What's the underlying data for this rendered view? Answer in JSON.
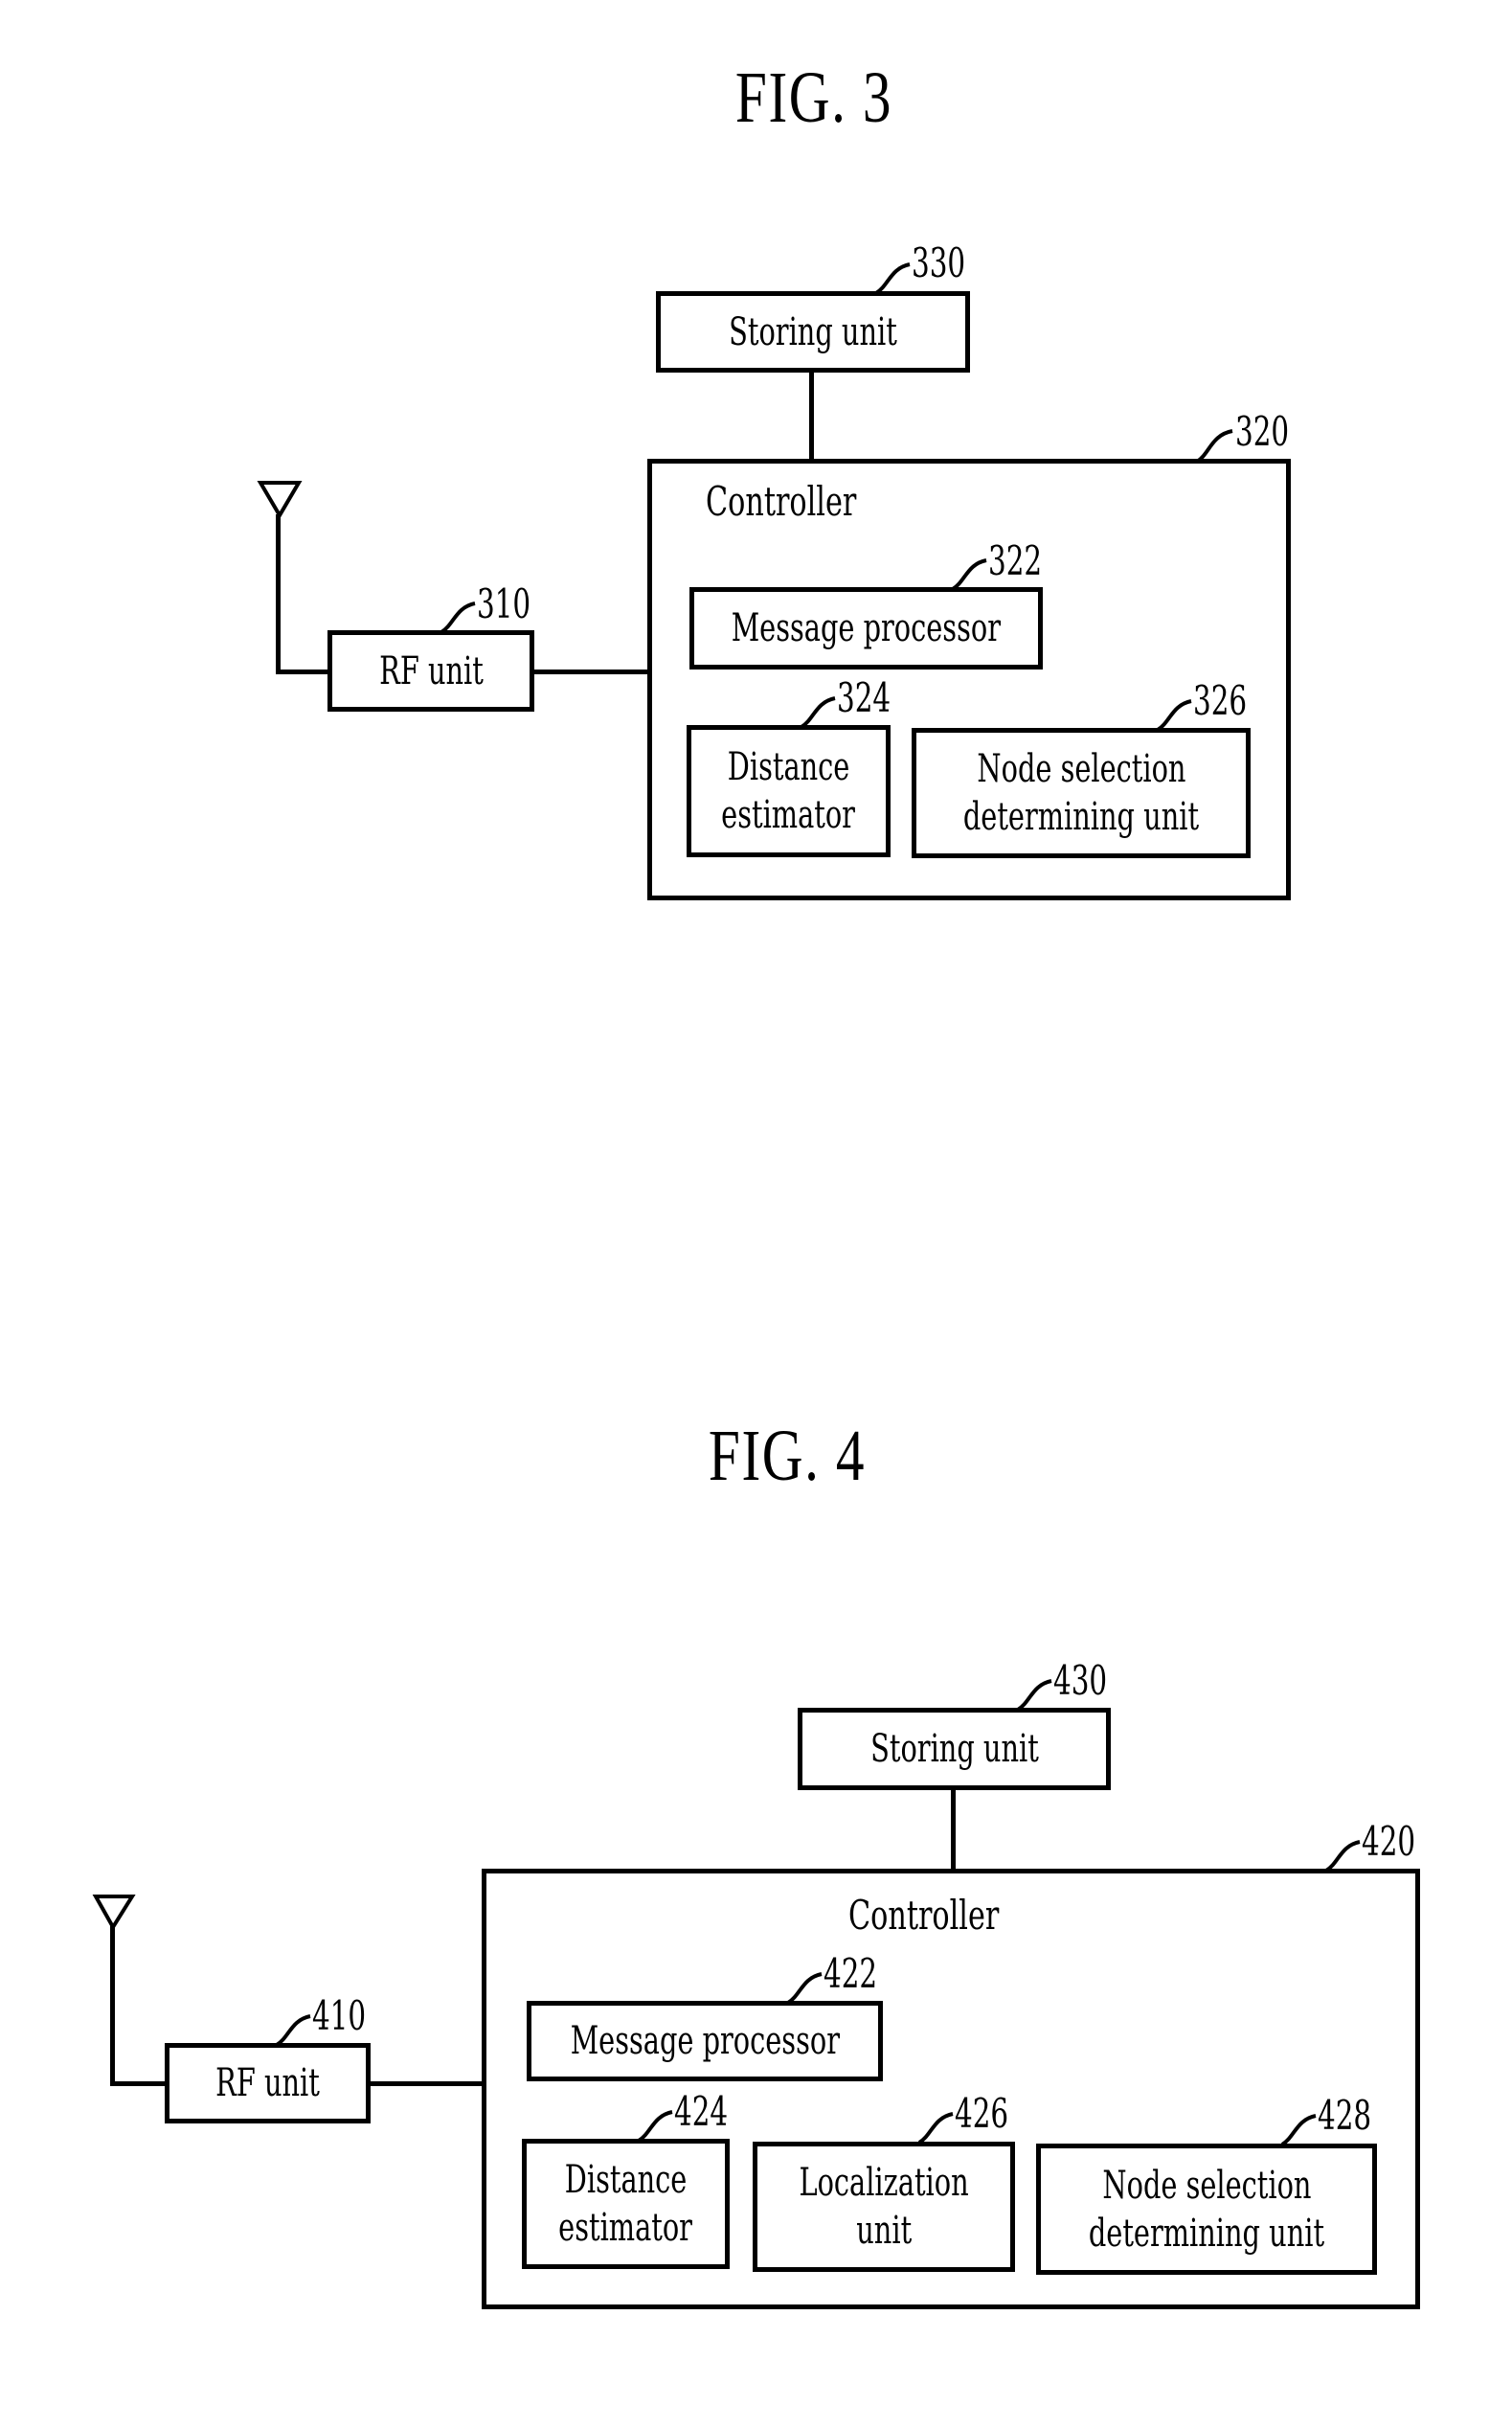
{
  "fig3": {
    "title": "FIG. 3",
    "storing_unit": {
      "label": "Storing unit",
      "ref": "330"
    },
    "controller": {
      "label": "Controller",
      "ref": "320"
    },
    "message_processor": {
      "label": "Message processor",
      "ref": "322"
    },
    "distance_estimator": {
      "label_line1": "Distance",
      "label_line2": "estimator",
      "ref": "324"
    },
    "node_selection": {
      "label_line1": "Node selection",
      "label_line2": "determining unit",
      "ref": "326"
    },
    "rf_unit": {
      "label": "RF unit",
      "ref": "310"
    },
    "antenna_icon": "antenna-icon"
  },
  "fig4": {
    "title": "FIG. 4",
    "storing_unit": {
      "label": "Storing unit",
      "ref": "430"
    },
    "controller": {
      "label": "Controller",
      "ref": "420"
    },
    "message_processor": {
      "label": "Message processor",
      "ref": "422"
    },
    "distance_estimator": {
      "label_line1": "Distance",
      "label_line2": "estimator",
      "ref": "424"
    },
    "localization_unit": {
      "label_line1": "Localization",
      "label_line2": "unit",
      "ref": "426"
    },
    "node_selection": {
      "label_line1": "Node selection",
      "label_line2": "determining unit",
      "ref": "428"
    },
    "rf_unit": {
      "label": "RF unit",
      "ref": "410"
    },
    "antenna_icon": "antenna-icon"
  }
}
